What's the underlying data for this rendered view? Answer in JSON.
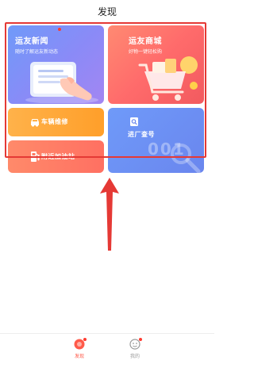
{
  "header": {
    "title": "发现"
  },
  "cards": {
    "news": {
      "title": "运友新闻",
      "subtitle": "随时了解运友新动态"
    },
    "mall": {
      "title": "运友商城",
      "subtitle": "好物一键轻松购"
    },
    "repair": {
      "title": "车辆维修"
    },
    "gas": {
      "title": "附近加油站"
    },
    "entry": {
      "title": "进厂查号",
      "number": "001"
    }
  },
  "tabbar": {
    "discover_label": "发现",
    "mine_label": "我的",
    "active_color": "#ff5a4a",
    "inactive_color": "#9a9a9a"
  },
  "colors": {
    "highlight": "#e53935"
  }
}
